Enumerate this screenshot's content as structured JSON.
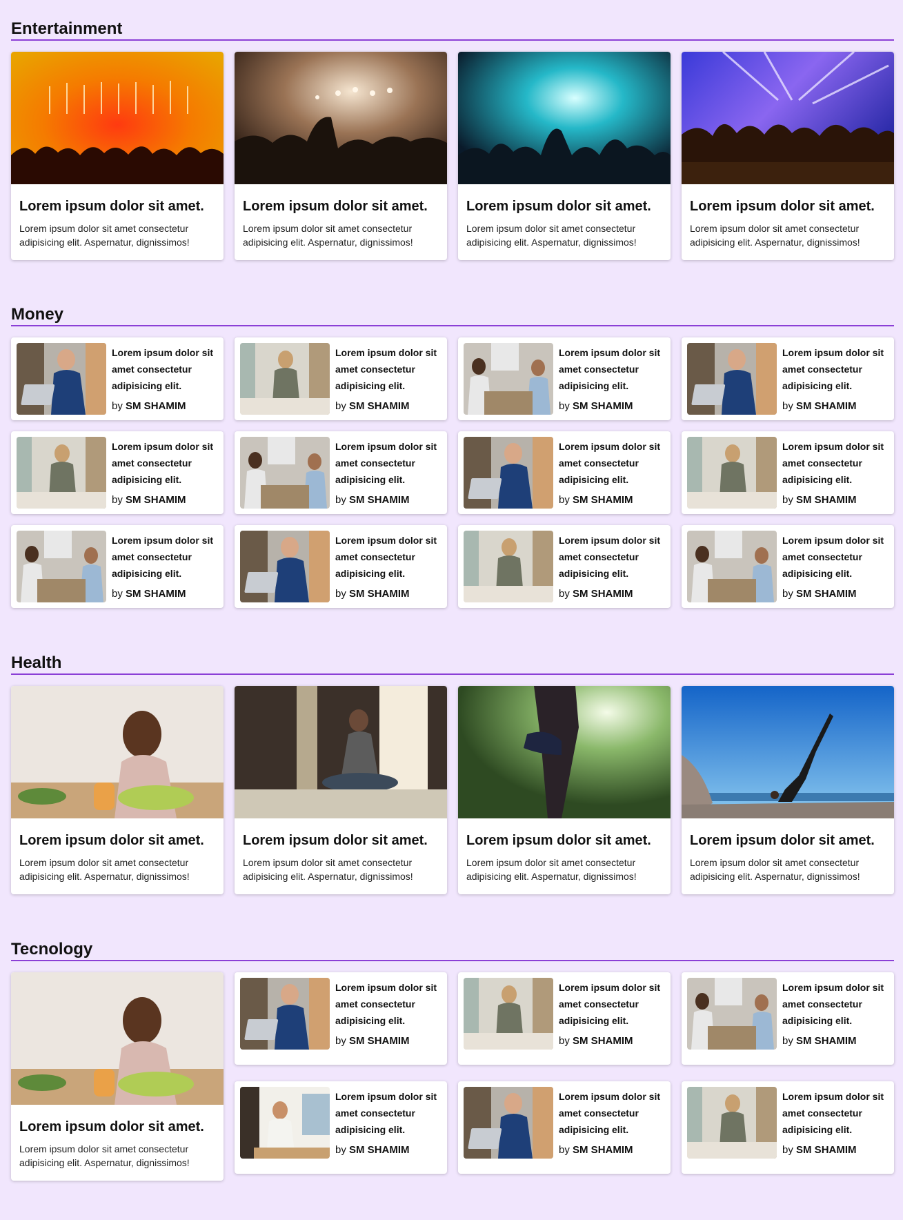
{
  "sections": {
    "entertainment": {
      "title": "Entertainment",
      "cards": [
        {
          "title": "Lorem ipsum dolor sit amet.",
          "text": "Lorem ipsum dolor sit amet consectetur adipisicing elit. Aspernatur, dignissimos!",
          "image": "concert-orange"
        },
        {
          "title": "Lorem ipsum dolor sit amet.",
          "text": "Lorem ipsum dolor sit amet consectetur adipisicing elit. Aspernatur, dignissimos!",
          "image": "concert-smoke"
        },
        {
          "title": "Lorem ipsum dolor sit amet.",
          "text": "Lorem ipsum dolor sit amet consectetur adipisicing elit. Aspernatur, dignissimos!",
          "image": "concert-teal"
        },
        {
          "title": "Lorem ipsum dolor sit amet.",
          "text": "Lorem ipsum dolor sit amet consectetur adipisicing elit. Aspernatur, dignissimos!",
          "image": "concert-purple"
        }
      ]
    },
    "money": {
      "title": "Money",
      "items": [
        {
          "l1": "Lorem ipsum dolor sit",
          "l2": "amet consectetur",
          "l3": "adipisicing elit.",
          "by": "by",
          "author": "SM SHAMIM",
          "image": "man-laptop"
        },
        {
          "l1": "Lorem ipsum dolor sit",
          "l2": "amet consectetur",
          "l3": "adipisicing elit.",
          "by": "by",
          "author": "SM SHAMIM",
          "image": "man-desk"
        },
        {
          "l1": "Lorem ipsum dolor sit",
          "l2": "amet consectetur",
          "l3": "adipisicing elit.",
          "by": "by",
          "author": "SM SHAMIM",
          "image": "meeting"
        },
        {
          "l1": "Lorem ipsum dolor sit",
          "l2": "amet consectetur",
          "l3": "adipisicing elit.",
          "by": "by",
          "author": "SM SHAMIM",
          "image": "man-laptop"
        },
        {
          "l1": "Lorem ipsum dolor sit",
          "l2": "amet consectetur",
          "l3": "adipisicing elit.",
          "by": "by",
          "author": "SM SHAMIM",
          "image": "man-desk"
        },
        {
          "l1": "Lorem ipsum dolor sit",
          "l2": "amet consectetur",
          "l3": "adipisicing elit.",
          "by": "by",
          "author": "SM SHAMIM",
          "image": "meeting"
        },
        {
          "l1": "Lorem ipsum dolor sit",
          "l2": "amet consectetur",
          "l3": "adipisicing elit.",
          "by": "by",
          "author": "SM SHAMIM",
          "image": "man-laptop"
        },
        {
          "l1": "Lorem ipsum dolor sit",
          "l2": "amet consectetur",
          "l3": "adipisicing elit.",
          "by": "by",
          "author": "SM SHAMIM",
          "image": "man-desk"
        },
        {
          "l1": "Lorem ipsum dolor sit",
          "l2": "amet consectetur",
          "l3": "adipisicing elit.",
          "by": "by",
          "author": "SM SHAMIM",
          "image": "meeting"
        },
        {
          "l1": "Lorem ipsum dolor sit",
          "l2": "amet consectetur",
          "l3": "adipisicing elit.",
          "by": "by",
          "author": "SM SHAMIM",
          "image": "man-laptop"
        },
        {
          "l1": "Lorem ipsum dolor sit",
          "l2": "amet consectetur",
          "l3": "adipisicing elit.",
          "by": "by",
          "author": "SM SHAMIM",
          "image": "man-desk"
        },
        {
          "l1": "Lorem ipsum dolor sit",
          "l2": "amet consectetur",
          "l3": "adipisicing elit.",
          "by": "by",
          "author": "SM SHAMIM",
          "image": "meeting"
        }
      ]
    },
    "health": {
      "title": "Health",
      "cards": [
        {
          "title": "Lorem ipsum dolor sit amet.",
          "text": "Lorem ipsum dolor sit amet consectetur adipisicing elit. Aspernatur, dignissimos!",
          "image": "woman-drinking"
        },
        {
          "title": "Lorem ipsum dolor sit amet.",
          "text": "Lorem ipsum dolor sit amet consectetur adipisicing elit. Aspernatur, dignissimos!",
          "image": "meditation"
        },
        {
          "title": "Lorem ipsum dolor sit amet.",
          "text": "Lorem ipsum dolor sit amet consectetur adipisicing elit. Aspernatur, dignissimos!",
          "image": "stretching"
        },
        {
          "title": "Lorem ipsum dolor sit amet.",
          "text": "Lorem ipsum dolor sit amet consectetur adipisicing elit. Aspernatur, dignissimos!",
          "image": "yoga-beach"
        }
      ]
    },
    "technology": {
      "title": "Tecnology",
      "feature": {
        "title": "Lorem ipsum dolor sit amet.",
        "text": "Lorem ipsum dolor sit amet consectetur adipisicing elit. Aspernatur, dignissimos!",
        "image": "woman-drinking"
      },
      "items": [
        {
          "l1": "Lorem ipsum dolor sit",
          "l2": "amet consectetur",
          "l3": "adipisicing elit.",
          "by": "by",
          "author": "SM SHAMIM",
          "image": "man-laptop"
        },
        {
          "l1": "Lorem ipsum dolor sit",
          "l2": "amet consectetur",
          "l3": "adipisicing elit.",
          "by": "by",
          "author": "SM SHAMIM",
          "image": "man-desk"
        },
        {
          "l1": "Lorem ipsum dolor sit",
          "l2": "amet consectetur",
          "l3": "adipisicing elit.",
          "by": "by",
          "author": "SM SHAMIM",
          "image": "meeting"
        },
        {
          "l1": "Lorem ipsum dolor sit",
          "l2": "amet consectetur",
          "l3": "adipisicing elit.",
          "by": "by",
          "author": "SM SHAMIM",
          "image": "man-window"
        },
        {
          "l1": "Lorem ipsum dolor sit",
          "l2": "amet consectetur",
          "l3": "adipisicing elit.",
          "by": "by",
          "author": "SM SHAMIM",
          "image": "man-laptop"
        },
        {
          "l1": "Lorem ipsum dolor sit",
          "l2": "amet consectetur",
          "l3": "adipisicing elit.",
          "by": "by",
          "author": "SM SHAMIM",
          "image": "man-desk"
        }
      ]
    }
  },
  "colors": {
    "background": "#f1e6fd",
    "accent": "#8b3fd6"
  }
}
